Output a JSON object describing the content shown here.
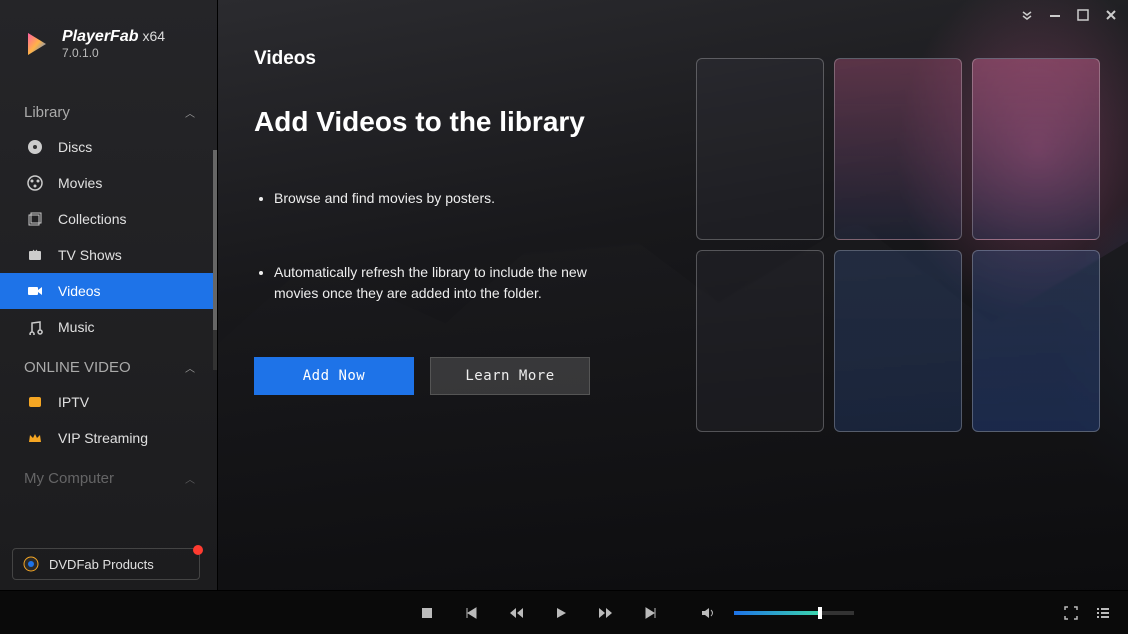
{
  "app": {
    "name": "PlayerFab",
    "arch": "x64",
    "version": "7.0.1.0"
  },
  "window_controls": {
    "dropdown_label": "dropdown",
    "minimize_label": "minimize",
    "maximize_label": "maximize",
    "close_label": "close"
  },
  "sidebar": {
    "section_library": "Library",
    "items_library": [
      {
        "label": "Discs"
      },
      {
        "label": "Movies"
      },
      {
        "label": "Collections"
      },
      {
        "label": "TV Shows"
      },
      {
        "label": "Videos"
      },
      {
        "label": "Music"
      }
    ],
    "section_online": "ONLINE VIDEO",
    "items_online": [
      {
        "label": "IPTV"
      },
      {
        "label": "VIP Streaming"
      }
    ],
    "section_computer": "My Computer",
    "promo_label": "DVDFab Products"
  },
  "main": {
    "page_title": "Videos",
    "heading": "Add Videos to the library",
    "bullet1": "Browse and find movies by posters.",
    "bullet2": "Automatically refresh the library to include the new movies once they are added into the folder."
  },
  "buttons": {
    "add_now": "Add Now",
    "learn_more": "Learn More"
  },
  "player": {
    "stop": "stop",
    "prev": "previous",
    "rewind": "rewind",
    "play": "play",
    "forward": "fast-forward",
    "next": "next",
    "volume": "volume",
    "fullscreen": "fullscreen",
    "playlist": "playlist"
  }
}
